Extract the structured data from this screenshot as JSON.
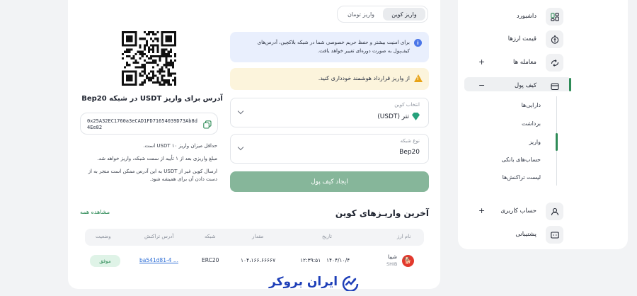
{
  "sidebar": {
    "items": [
      {
        "label": "داشبورد",
        "icon": "dashboard-icon"
      },
      {
        "label": "قیمت ارزها",
        "icon": "price-icon"
      },
      {
        "label": "معامله ها",
        "icon": "trade-icon",
        "toggle": "+"
      },
      {
        "label": "کیف پول",
        "icon": "wallet-icon",
        "toggle": "−"
      },
      {
        "label": "حساب کاربری",
        "icon": "user-icon",
        "toggle": "+"
      },
      {
        "label": "پشتیبانی",
        "icon": "support-icon"
      }
    ],
    "wallet_sub": [
      "دارایی‌ها",
      "برداشت",
      "واریز",
      "حساب‌های بانکی",
      "لیست تراکنش‌ها"
    ]
  },
  "tabs": {
    "coin": "واریز کوین",
    "toman": "واریز تومان"
  },
  "info": {
    "text": "برای امنیت بیشتر و حفظ حریم خصوصی شما در شبکه بلاکچین، آدرس‌های کیف‌پول به صورت دوره‌ای تغییر خواهد یافت."
  },
  "warning": {
    "text": "از واریز قرارداد هوشمند خودداری کنید."
  },
  "coin_select": {
    "label": "انتخاب کوین",
    "value": "تتر (USDT)"
  },
  "network_select": {
    "label": "نوع شبکه",
    "value": "Bep20"
  },
  "create_button": "ایجاد کیف پول",
  "address": {
    "title": "آدرس برای واریز USDT در شبکه Bep20",
    "value": "0x25A32EC1760a3eCAD1FD71654039D73Ab8d4Ee82"
  },
  "notes": [
    "حداقل میزان واریز ۱۰ USDT است.",
    "مبلغ واریزی بعد از ۱ تأیید از سمت شبکه، واریز خواهد شد.",
    "ارسال کوین غیر از USDT به این آدرس ممکن است منجر به از دست دادن آن برای همیشه شود."
  ],
  "deposits": {
    "title": "آخرین واریـزهای کوین",
    "view_all": "مشاهده همه",
    "headers": [
      "نام ارز",
      "تاریخ",
      "مقدار",
      "شبکه",
      "آدرس تراکنش",
      "وضعیت"
    ],
    "rows": [
      {
        "coin_name": "شیبا",
        "coin_symbol": "SHIB",
        "date": "۱۴۰۴/۱۰/۴",
        "time": "۱۲:۳۹:۵۱",
        "amount": "۱۰۴،۱۶۶.۶۶۶۶۷",
        "network": "ERC20",
        "txid": "ba541d81-4 ...",
        "status": "موفق"
      }
    ]
  },
  "logo": {
    "text": "ایران بروکر"
  },
  "colors": {
    "accent": "#2e8b57",
    "button": "#86b69a",
    "info_bg": "#e9effd",
    "warn_bg": "#fcf4dc"
  }
}
